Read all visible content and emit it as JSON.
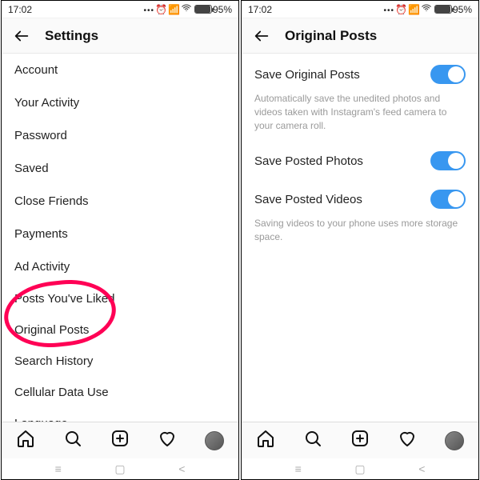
{
  "status": {
    "time": "17:02",
    "battery_pct": "95%"
  },
  "left": {
    "title": "Settings",
    "items": [
      "Account",
      "Your Activity",
      "Password",
      "Saved",
      "Close Friends",
      "Payments",
      "Ad Activity",
      "Posts You've Liked",
      "Original Posts",
      "Search History",
      "Cellular Data Use",
      "Language"
    ]
  },
  "right": {
    "title": "Original Posts",
    "opts": [
      {
        "label": "Save Original Posts",
        "on": true
      },
      {
        "label": "Save Posted Photos",
        "on": true
      },
      {
        "label": "Save Posted Videos",
        "on": true
      }
    ],
    "desc1": "Automatically save the unedited photos and videos taken with Instagram's feed camera to your camera roll.",
    "desc2": "Saving videos to your phone uses more storage space."
  }
}
